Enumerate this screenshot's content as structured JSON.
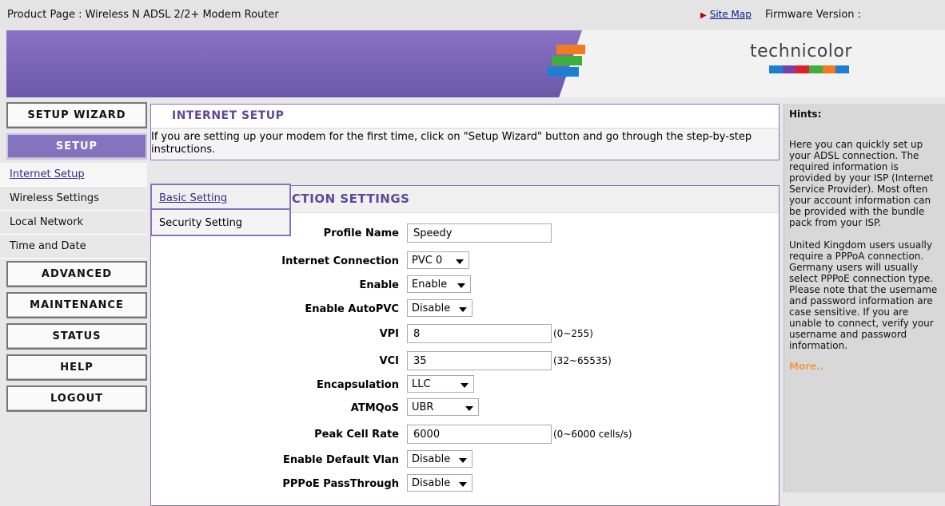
{
  "topbar": {
    "product": "Product Page : Wireless N ADSL 2/2+ Modem Router",
    "site_map": "Site Map",
    "firmware": "Firmware Version :"
  },
  "brand": {
    "logo_text": "technicolor",
    "colors": {
      "accent": "#8573bf",
      "stripe_orange": "#f47a1f",
      "stripe_green": "#3fae3a",
      "stripe_blue": "#1e7fd0"
    }
  },
  "nav": {
    "setup_wizard": "SETUP WIZARD",
    "setup": "SETUP",
    "sublinks": [
      "Internet Setup",
      "Wireless Settings",
      "Local Network",
      "Time and Date"
    ],
    "advanced": "ADVANCED",
    "maintenance": "MAINTENANCE",
    "status": "STATUS",
    "help": "HELP",
    "logout": "LOGOUT"
  },
  "internet_setup": {
    "title": "INTERNET SETUP",
    "description": "If you are setting up your modem for the first time, click on \"Setup Wizard\" button and go through the step-by-step instructions."
  },
  "submenu": {
    "basic": "Basic Setting",
    "security": "Security Setting"
  },
  "connection": {
    "title_visible": "CTION SETTINGS",
    "fields": {
      "profile_name": {
        "label": "Profile Name",
        "value": "Speedy"
      },
      "internet_connection": {
        "label": "Internet Connection",
        "value": "PVC 0"
      },
      "enable": {
        "label": "Enable",
        "value": "Enable"
      },
      "enable_autopvc": {
        "label": "Enable AutoPVC",
        "value": "Disable"
      },
      "vpi": {
        "label": "VPI",
        "value": "8",
        "range": "(0~255)"
      },
      "vci": {
        "label": "VCI",
        "value": "35",
        "range": "(32~65535)"
      },
      "encapsulation": {
        "label": "Encapsulation",
        "value": "LLC"
      },
      "atmqos": {
        "label": "ATMQoS",
        "value": "UBR"
      },
      "peak_cell_rate": {
        "label": "Peak Cell Rate",
        "value": "6000",
        "range": "(0~6000 cells/s)"
      },
      "enable_default_vlan": {
        "label": "Enable Default Vlan",
        "value": "Disable"
      },
      "pppoe_passthrough": {
        "label": "PPPoE PassThrough",
        "value": "Disable"
      }
    }
  },
  "hints": {
    "title": "Hints:",
    "p1": "Here you can quickly set up your ADSL connection. The required information is provided by your ISP (Internet Service Provider). Most often your account information can be provided with the bundle pack from your ISP.",
    "p2": "United Kingdom users usually require a PPPoA connection. Germany users will usually select PPPoE connection type. Please note that the username and password information are case sensitive. If you are unable to connect, verify your username and password information.",
    "more": "More.."
  }
}
